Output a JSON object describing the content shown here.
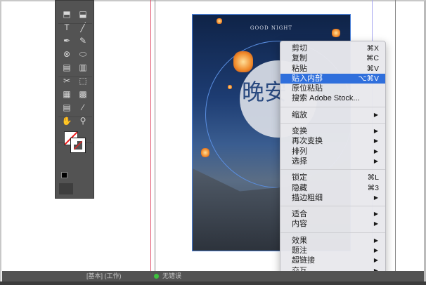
{
  "toolbar": {
    "tools": [
      "content-collector",
      "content-placer",
      "type",
      "line",
      "pen",
      "pencil",
      "rectangle-frame",
      "ellipse",
      "gridify-h",
      "gridify-v",
      "scissors",
      "free-transform",
      "gradient-swatch",
      "gradient-feather",
      "note",
      "eyedropper",
      "hand",
      "zoom"
    ],
    "type_label": "T"
  },
  "poster": {
    "title": "GOOD NIGHT",
    "headline": "晚安"
  },
  "context_menu": {
    "groups": [
      [
        {
          "label": "剪切",
          "shortcut": "⌘X"
        },
        {
          "label": "复制",
          "shortcut": "⌘C"
        },
        {
          "label": "粘贴",
          "shortcut": "⌘V"
        },
        {
          "label": "贴入内部",
          "shortcut": "⌥⌘V",
          "highlighted": true
        },
        {
          "label": "原位粘贴"
        },
        {
          "label": "搜索 Adobe Stock..."
        }
      ],
      [
        {
          "label": "缩放",
          "submenu": true
        }
      ],
      [
        {
          "label": "变换",
          "submenu": true
        },
        {
          "label": "再次变换",
          "submenu": true
        },
        {
          "label": "排列",
          "submenu": true
        },
        {
          "label": "选择",
          "submenu": true
        }
      ],
      [
        {
          "label": "锁定",
          "shortcut": "⌘L"
        },
        {
          "label": "隐藏",
          "shortcut": "⌘3"
        },
        {
          "label": "描边粗细",
          "submenu": true
        }
      ],
      [
        {
          "label": "适合",
          "submenu": true
        },
        {
          "label": "内容",
          "submenu": true
        }
      ],
      [
        {
          "label": "效果",
          "submenu": true
        },
        {
          "label": "题注",
          "submenu": true
        },
        {
          "label": "超链接",
          "submenu": true
        },
        {
          "label": "交互",
          "submenu": true
        }
      ]
    ],
    "submenu_arrow": "▶"
  },
  "status": {
    "profile": "[基本] (工作)",
    "preflight": "无错误"
  },
  "colors": {
    "highlight": "#2f6fdc",
    "panel": "#535353",
    "guide_red": "#e0506a",
    "guide_purple": "#a8a8f0"
  }
}
